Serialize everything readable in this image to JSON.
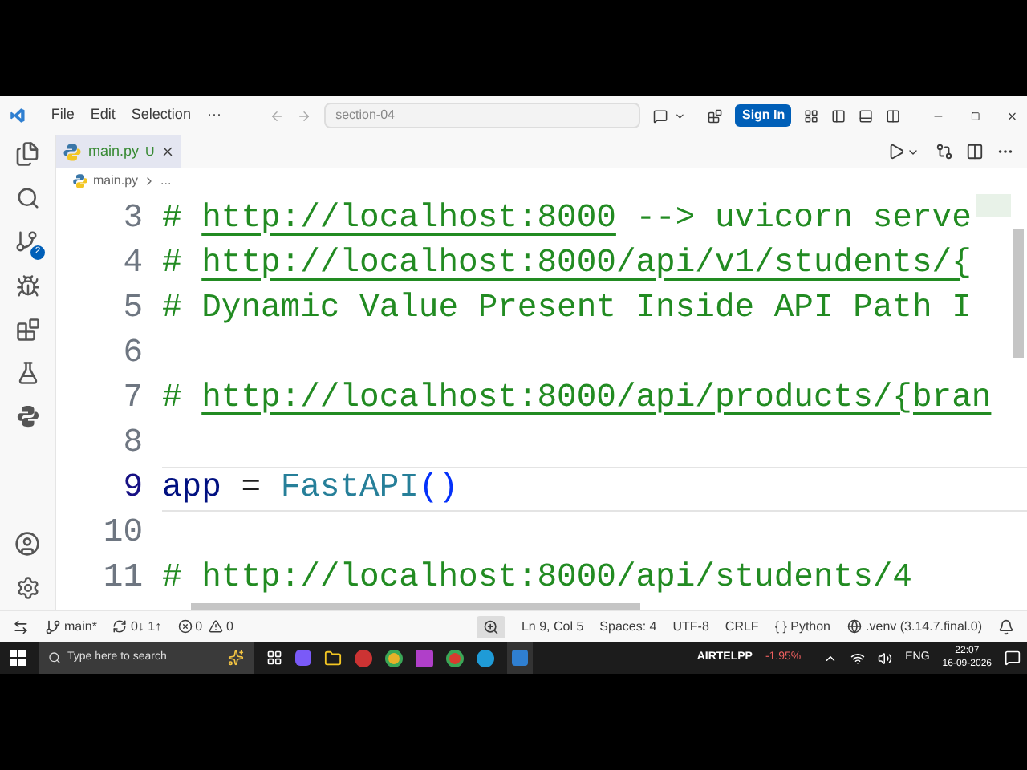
{
  "title_bar": {
    "menus": [
      "File",
      "Edit",
      "Selection",
      "···"
    ],
    "search": "section-04",
    "sign_in": "Sign In"
  },
  "tabs": [
    {
      "label": "main.py",
      "badge": "U",
      "selected": true
    }
  ],
  "breadcrumb": {
    "file": "main.py",
    "rest": "..."
  },
  "activity_bar": {
    "source_control_badge": "2"
  },
  "editor": {
    "lines": [
      {
        "number": "3",
        "current": false,
        "tokens": [
          {
            "kind": "comment",
            "text": "# "
          },
          {
            "kind": "link",
            "text": "http://localhost:8000"
          },
          {
            "kind": "comment",
            "text": " --> uvicorn serve"
          }
        ]
      },
      {
        "number": "4",
        "current": false,
        "tokens": [
          {
            "kind": "comment",
            "text": "# "
          },
          {
            "kind": "link",
            "text": "http://localhost:8000/api/v1/students/{"
          }
        ]
      },
      {
        "number": "5",
        "current": false,
        "tokens": [
          {
            "kind": "comment",
            "text": "# Dynamic Value Present Inside API Path I"
          }
        ]
      },
      {
        "number": "6",
        "current": false
      },
      {
        "number": "7",
        "current": false,
        "tokens": [
          {
            "kind": "comment",
            "text": "# "
          },
          {
            "kind": "link",
            "text": "http://localhost:8000/api/products/{bran"
          }
        ]
      },
      {
        "number": "8",
        "current": false
      },
      {
        "number": "9",
        "current": true,
        "tokens": [
          {
            "kind": "variable",
            "text": "app"
          },
          {
            "kind": "plain",
            "text": " = "
          },
          {
            "kind": "function",
            "text": "FastAPI"
          },
          {
            "kind": "punct",
            "text": "()"
          }
        ]
      },
      {
        "number": "10",
        "current": false
      },
      {
        "number": "11",
        "current": false,
        "tokens": [
          {
            "kind": "comment",
            "text": "# http://localhost:8000/api/students/4"
          }
        ]
      }
    ]
  },
  "status_bar": {
    "branch": "main*",
    "sync": "0↓ 1↑",
    "errors": "0",
    "warnings": "0",
    "items": [
      "Ln 9, Col 5",
      "Spaces: 4",
      "UTF-8",
      "CRLF",
      "{ } Python"
    ],
    "env": ".venv (3.14.7.final.0)"
  },
  "taskbar": {
    "search_placeholder": "Type here to search",
    "stock_name": "AIRTELPP",
    "stock_change": "-1.95%",
    "language": "ENG",
    "time": "22:07",
    "date": "16-09-2026"
  }
}
